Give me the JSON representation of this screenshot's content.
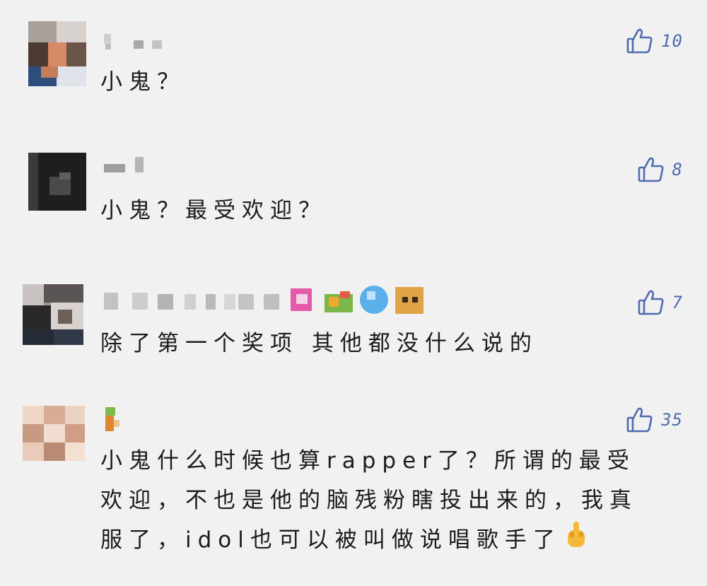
{
  "comments": [
    {
      "text": "小鬼？",
      "likes": "10"
    },
    {
      "text": "小鬼？最受欢迎？",
      "likes": "8"
    },
    {
      "text": "除了第一个奖项 其他都没什么说的",
      "likes": "7"
    },
    {
      "text": "小鬼什么时候也算rapper了？所谓的最受欢迎，不也是他的脑残粉瞎投出来的，我真服了，idol也可以被叫做说唱歌手了",
      "likes": "35"
    }
  ],
  "icons": {
    "like": "thumbs-up-icon",
    "finger_emoji": "middle-finger-emoji"
  },
  "colors": {
    "background": "#f1f1f1",
    "like_blue": "#4f6bb0",
    "text": "#1b1b1b"
  }
}
